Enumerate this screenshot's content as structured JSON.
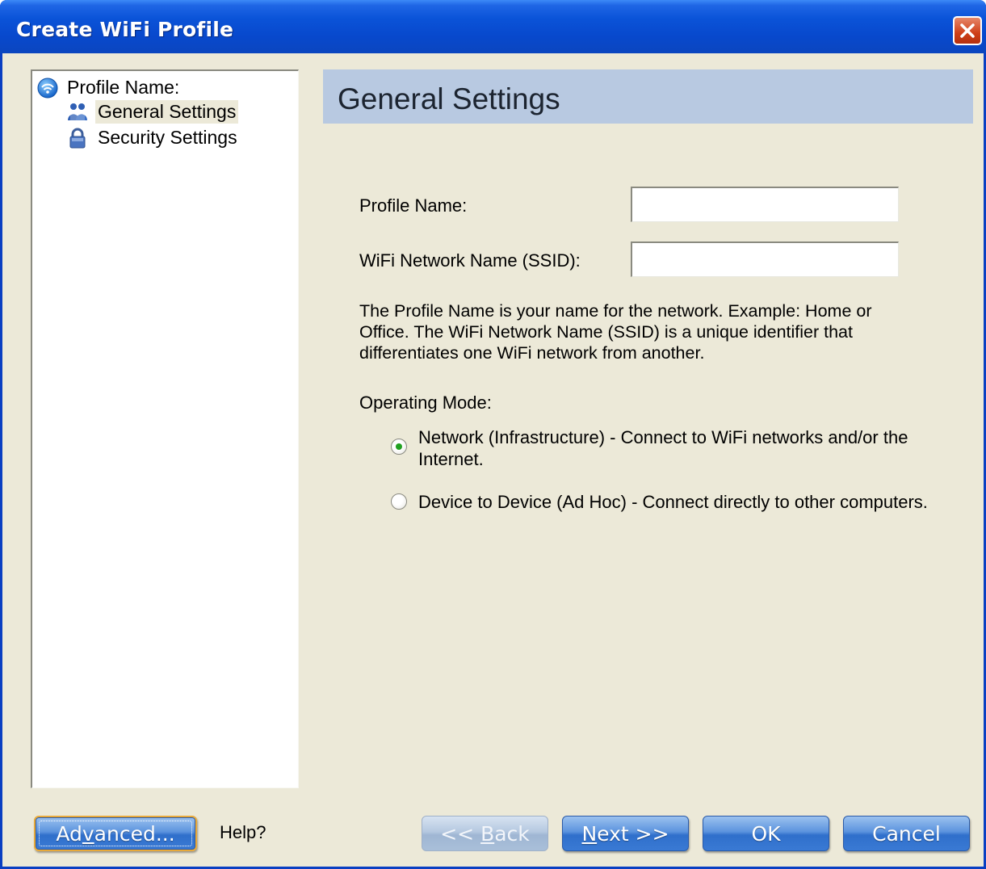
{
  "window": {
    "title": "Create WiFi Profile",
    "close_icon": "close-x-icon"
  },
  "tree": {
    "root_label": "Profile Name:",
    "root_icon": "wifi-globe-icon",
    "items": [
      {
        "label": "General Settings",
        "icon": "people-icon",
        "selected": true
      },
      {
        "label": "Security Settings",
        "icon": "padlock-icon",
        "selected": false
      }
    ]
  },
  "header": {
    "title": "General Settings",
    "background": "#b8c9e1"
  },
  "form": {
    "profile_name_label": "Profile Name:",
    "profile_name_value": "",
    "ssid_label": "WiFi Network Name (SSID):",
    "ssid_value": "",
    "description": "The Profile Name is your name for the network. Example: Home or Office. The WiFi Network Name (SSID) is a unique identifier that differentiates one WiFi network from another.",
    "operating_mode_label": "Operating Mode:",
    "modes": [
      {
        "label": "Network (Infrastructure) - Connect to WiFi networks and/or the Internet.",
        "selected": true
      },
      {
        "label": "Device to Device (Ad Hoc) - Connect directly to other computers.",
        "selected": false
      }
    ]
  },
  "footer": {
    "advanced_pre": "Ad",
    "advanced_key": "v",
    "advanced_post": "anced...",
    "help_label": "Help?",
    "back_pre": "<< ",
    "back_key": "B",
    "back_post": "ack",
    "back_disabled": true,
    "next_key": "N",
    "next_post": "ext >>",
    "ok_label": "OK",
    "cancel_label": "Cancel"
  },
  "colors": {
    "titlebar": "#0848cc",
    "dialog_bg": "#ece9d8",
    "button_blue": "#3a7ad4",
    "close_red": "#cf3f18"
  }
}
